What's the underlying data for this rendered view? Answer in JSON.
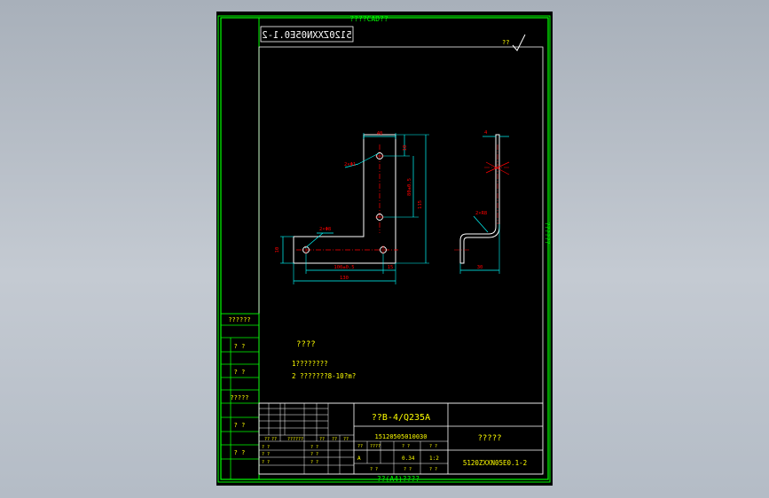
{
  "colors": {
    "frame": "#00ff00",
    "geometry": "#ffffff",
    "dimension": "#00ffff",
    "annotation": "#ff0000",
    "text": "#ffff00",
    "background": "#000000",
    "desktop": "#b8c0ca"
  },
  "sheet": {
    "top_label": "????CAD??",
    "bottom_label": "??(A4)????",
    "side_label": "??????",
    "mirrored_code": "5120ZXXN05E0.1-2",
    "roughness_symbol": "??"
  },
  "left_column": {
    "rows": [
      "??????",
      "? ?",
      "? ?",
      "?????",
      "? ?",
      "? ?"
    ]
  },
  "notes": {
    "heading": "????",
    "line1": "1????????",
    "line2": "2 ???????8-10?m?"
  },
  "dimensions": {
    "top_width": "40",
    "hole_label_top": "2×Φ1",
    "hole_label_bottom": "2×Φ8",
    "vertical_inner": "80±0.5",
    "vertical_total": "115",
    "left_height": "10",
    "top_offset": "10",
    "hole_spacing": "100±0.5",
    "right_offset": "15",
    "total_width": "130",
    "side_thickness": "4",
    "side_radius": "2×R8",
    "side_width": "30"
  },
  "title_block": {
    "material": "??B-4/Q235A",
    "drawing_number": "15120505010030",
    "name": "?????",
    "code": "5120ZXXN05E0.1-2",
    "header_labels": [
      "??",
      "??",
      "??????",
      "??",
      "??",
      "??"
    ],
    "rows_left": [
      [
        "? ?",
        "",
        "",
        "",
        "",
        "? ?"
      ],
      [
        "? ?",
        "",
        "",
        "",
        "",
        "? ?"
      ],
      [
        "? ?",
        "",
        "",
        "",
        "",
        "? ?"
      ]
    ],
    "stage_headers": [
      "??",
      "????",
      "? ?",
      "? ?"
    ],
    "stage_values": [
      "A",
      "",
      "0.34",
      "1:2"
    ],
    "sheet_row": [
      "? ?",
      "? ?",
      "? ?"
    ]
  }
}
